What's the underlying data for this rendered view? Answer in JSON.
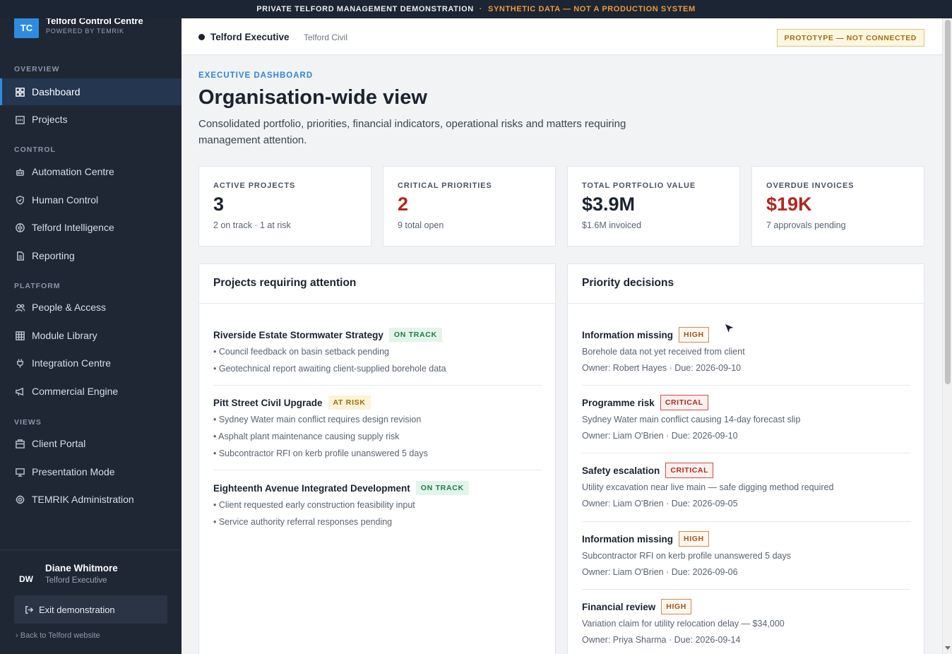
{
  "banner": {
    "left": "PRIVATE TELFORD MANAGEMENT DEMONSTRATION",
    "separator": "·",
    "right": "SYNTHETIC DATA — NOT A PRODUCTION SYSTEM"
  },
  "brand": {
    "logo": "TC",
    "name": "Telford Control Centre",
    "tagline": "POWERED BY TEMRIK",
    "accent": "#2f8be0"
  },
  "sidebar": {
    "sections": [
      "OVERVIEW",
      "CONTROL",
      "PLATFORM",
      "VIEWS"
    ],
    "items": [
      {
        "label": "Dashboard",
        "icon": "grid-icon",
        "active": true
      },
      {
        "label": "Projects",
        "icon": "building-icon"
      },
      {
        "label": "Automation Centre",
        "icon": "robot-icon"
      },
      {
        "label": "Human Control",
        "icon": "shield-icon"
      },
      {
        "label": "Telford Intelligence",
        "icon": "brain-icon"
      },
      {
        "label": "Reporting",
        "icon": "report-icon"
      },
      {
        "label": "People & Access",
        "icon": "users-icon"
      },
      {
        "label": "Module Library",
        "icon": "table-icon"
      },
      {
        "label": "Integration Centre",
        "icon": "plug-icon"
      },
      {
        "label": "Commercial Engine",
        "icon": "megaphone-icon"
      },
      {
        "label": "Client Portal",
        "icon": "portal-icon"
      },
      {
        "label": "Presentation Mode",
        "icon": "monitor-icon"
      },
      {
        "label": "TEMRIK Administration",
        "icon": "gear-icon"
      }
    ]
  },
  "user": {
    "initials": "DW",
    "name": "Diane Whitmore",
    "role": "Telford Executive",
    "avatar_color": "#1f2735",
    "exit_label": "Exit demonstration",
    "back_label": "Back to Telford website"
  },
  "topbar": {
    "org": "Telford Executive",
    "sub": "Telford Civil",
    "badge": "PROTOTYPE — NOT CONNECTED"
  },
  "header": {
    "eyebrow": "EXECUTIVE DASHBOARD",
    "title": "Organisation-wide view",
    "description": "Consolidated portfolio, priorities, financial indicators, operational risks and matters requiring management attention."
  },
  "stats": [
    {
      "label": "ACTIVE PROJECTS",
      "value": "3",
      "note": "2 on track · 1 at risk",
      "alert": false
    },
    {
      "label": "CRITICAL PRIORITIES",
      "value": "2",
      "note": "9 total open",
      "alert": true
    },
    {
      "label": "TOTAL PORTFOLIO VALUE",
      "value": "$3.9M",
      "note": "$1.6M invoiced",
      "alert": false
    },
    {
      "label": "OVERDUE INVOICES",
      "value": "$19K",
      "note": "7 approvals pending",
      "alert": true
    }
  ],
  "projects_panel": {
    "title": "Projects requiring attention",
    "projects": [
      {
        "name": "Riverside Estate Stormwater Strategy",
        "status": "ON TRACK",
        "status_kind": "ok",
        "notes": [
          "• Council feedback on basin setback pending",
          "• Geotechnical report awaiting client-supplied borehole data"
        ]
      },
      {
        "name": "Pitt Street Civil Upgrade",
        "status": "AT RISK",
        "status_kind": "risk",
        "notes": [
          "• Sydney Water main conflict requires design revision",
          "• Asphalt plant maintenance causing supply risk",
          "• Subcontractor RFI on kerb profile unanswered 5 days"
        ]
      },
      {
        "name": "Eighteenth Avenue Integrated Development",
        "status": "ON TRACK",
        "status_kind": "ok",
        "notes": [
          "• Client requested early construction feasibility input",
          "• Service authority referral responses pending"
        ]
      }
    ]
  },
  "decisions_panel": {
    "title": "Priority decisions",
    "decisions": [
      {
        "title": "Information missing",
        "level": "HIGH",
        "kind": "high",
        "desc": "Borehole data not yet received from client",
        "owner": "Owner: Robert Hayes · Due: 2026-09-10"
      },
      {
        "title": "Programme risk",
        "level": "CRITICAL",
        "kind": "crit",
        "desc": "Sydney Water main conflict causing 14-day forecast slip",
        "owner": "Owner: Liam O'Brien · Due: 2026-09-10"
      },
      {
        "title": "Safety escalation",
        "level": "CRITICAL",
        "kind": "crit",
        "desc": "Utility excavation near live main — safe digging method required",
        "owner": "Owner: Liam O'Brien · Due: 2026-09-05"
      },
      {
        "title": "Information missing",
        "level": "HIGH",
        "kind": "high",
        "desc": "Subcontractor RFI on kerb profile unanswered 5 days",
        "owner": "Owner: Liam O'Brien · Due: 2026-09-06"
      },
      {
        "title": "Financial review",
        "level": "HIGH",
        "kind": "high",
        "desc": "Variation claim for utility relocation delay — $34,000",
        "owner": "Owner: Priya Sharma · Due: 2026-09-14"
      }
    ]
  }
}
